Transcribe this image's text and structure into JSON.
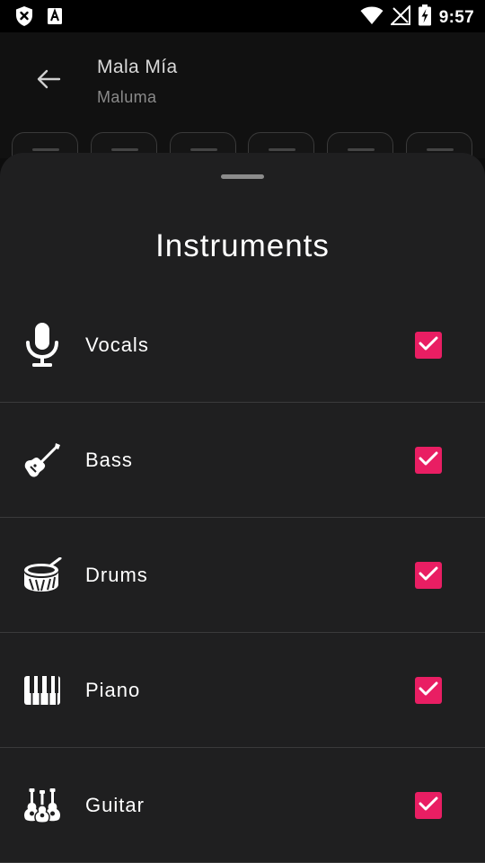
{
  "status_bar": {
    "time": "9:57",
    "left_icons": [
      "shield-x-icon",
      "font-a-icon"
    ],
    "right_icons": [
      "wifi-icon",
      "no-signal-icon",
      "battery-charging-icon"
    ]
  },
  "header": {
    "back_icon": "arrow-left-icon",
    "title": "Mala Mía",
    "subtitle": "Maluma"
  },
  "sheet": {
    "title": "Instruments",
    "items": [
      {
        "label": "Vocals",
        "icon": "microphone-icon",
        "checked": true
      },
      {
        "label": "Bass",
        "icon": "bass-guitar-icon",
        "checked": true
      },
      {
        "label": "Drums",
        "icon": "drum-icon",
        "checked": true
      },
      {
        "label": "Piano",
        "icon": "piano-icon",
        "checked": true
      },
      {
        "label": "Guitar",
        "icon": "guitars-icon",
        "checked": true
      }
    ]
  },
  "colors": {
    "accent": "#e91e63",
    "sheet_background": "#1f1f20",
    "app_background": "#111111"
  }
}
